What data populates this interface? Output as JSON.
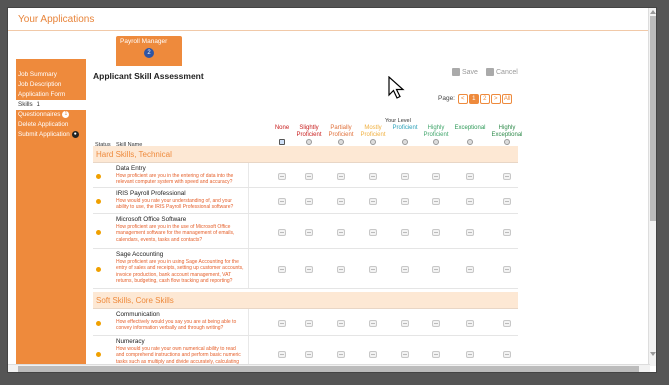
{
  "app_title": "Your Applications",
  "tab": {
    "label": "Payroll Manager",
    "badge": "2"
  },
  "sidebar": {
    "items": [
      {
        "label": "Job Summary",
        "badge": ""
      },
      {
        "label": "Job Description",
        "badge": ""
      },
      {
        "label": "Application Form",
        "badge": ""
      },
      {
        "label": "Skills",
        "badge": "1"
      },
      {
        "label": "Questionnaires",
        "badge": "1"
      },
      {
        "label": "Delete Application",
        "badge": ""
      },
      {
        "label": "Submit Application",
        "badge": ""
      }
    ]
  },
  "page": {
    "title": "Applicant Skill Assessment",
    "save_label": "Save",
    "cancel_label": "Cancel",
    "page_label": "Page:",
    "pager": [
      "<",
      "1",
      "2",
      ">",
      "All"
    ],
    "your_level": "Your Level",
    "status_header": "Status",
    "skill_header": "Skill Name",
    "levels": [
      {
        "label": "None",
        "color": "#c81e1e"
      },
      {
        "label": "Slightly Proficient",
        "color": "#c81e1e"
      },
      {
        "label": "Partially Proficient",
        "color": "#e0703a"
      },
      {
        "label": "Mostly Proficient",
        "color": "#f0b040"
      },
      {
        "label": "Proficient",
        "color": "#2aa0b8"
      },
      {
        "label": "Highly Proficient",
        "color": "#3fa56a"
      },
      {
        "label": "Exceptional",
        "color": "#2e9a58"
      },
      {
        "label": "Highly Exceptional",
        "color": "#2e8a4a"
      }
    ]
  },
  "sections": [
    {
      "title": "Hard Skills, Technical",
      "skills": [
        {
          "name": "Data Entry",
          "desc": "How proficient are you in the entering of data into the relevant computer system with speed and accuracy?"
        },
        {
          "name": "IRIS Payroll Professional",
          "desc": "How would you rate your understanding of, and your ability to use, the IRIS Payroll Professional software?"
        },
        {
          "name": "Microsoft Office Software",
          "desc": "How proficient are you in the use of Microsoft Office management software for the management of emails, calendars, events, tasks and contacts?"
        },
        {
          "name": "Sage Accounting",
          "desc": "How proficient are you in using Sage Accounting for the entry of sales and receipts, setting up customer accounts, invoice production, bank account management, VAT returns, budgeting, cash flow tracking and reporting?"
        }
      ]
    },
    {
      "title": "Soft Skills, Core Skills",
      "skills": [
        {
          "name": "Communication",
          "desc": "How effectively would you say you are at being able to convey information verbally and through writing?"
        },
        {
          "name": "Numeracy",
          "desc": "How would you rate your own numerical ability to read and comprehend instructions and perform basic numeric tasks such as multiply and divide accurately, calculating and estimating for commercial usage and ..."
        }
      ]
    }
  ],
  "colors": {
    "accent": "#ee8a3c",
    "section_bg": "#fde8d4",
    "badge_blue": "#2f55a4",
    "desc_text": "#e55f2a"
  }
}
